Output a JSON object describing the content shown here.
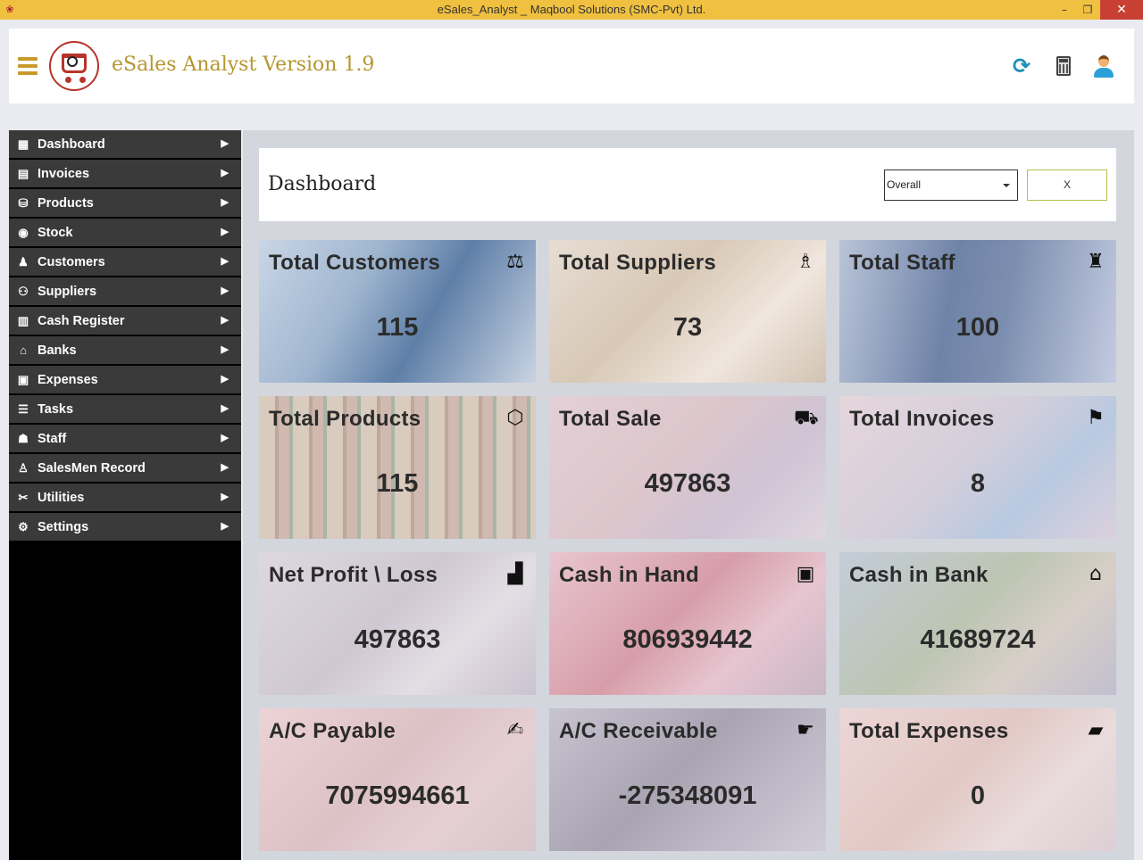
{
  "window": {
    "title": "eSales_Analyst _ Maqbool Solutions (SMC-Pvt) Ltd.",
    "minimize": "–",
    "maximize": "❐",
    "close": "✕"
  },
  "header": {
    "app_name": "eSales Analyst Version 1.9",
    "icons": [
      "refresh-icon",
      "calculator-icon",
      "user-icon"
    ]
  },
  "sidebar": {
    "items": [
      {
        "label": "Dashboard",
        "icon": "dashboard-icon"
      },
      {
        "label": "Invoices",
        "icon": "invoice-icon"
      },
      {
        "label": "Products",
        "icon": "products-icon"
      },
      {
        "label": "Stock",
        "icon": "stock-icon"
      },
      {
        "label": "Customers",
        "icon": "customers-icon"
      },
      {
        "label": "Suppliers",
        "icon": "suppliers-icon"
      },
      {
        "label": "Cash Register",
        "icon": "cash-register-icon"
      },
      {
        "label": "Banks",
        "icon": "bank-icon"
      },
      {
        "label": "Expenses",
        "icon": "expenses-icon"
      },
      {
        "label": "Tasks",
        "icon": "tasks-icon"
      },
      {
        "label": "Staff",
        "icon": "staff-icon"
      },
      {
        "label": "SalesMen Record",
        "icon": "salesmen-icon"
      },
      {
        "label": "Utilities",
        "icon": "utilities-icon"
      },
      {
        "label": "Settings",
        "icon": "settings-icon"
      }
    ]
  },
  "dashboard": {
    "title": "Dashboard",
    "filter_value": "Overall",
    "close_label": "X",
    "cards": [
      {
        "label": "Total Customers",
        "value": "115"
      },
      {
        "label": "Total Suppliers",
        "value": "73"
      },
      {
        "label": "Total Staff",
        "value": "100"
      },
      {
        "label": "Total Products",
        "value": "115"
      },
      {
        "label": "Total Sale",
        "value": "497863"
      },
      {
        "label": "Total Invoices",
        "value": "8"
      },
      {
        "label": "Net Profit \\ Loss",
        "value": "497863"
      },
      {
        "label": "Cash in Hand",
        "value": "806939442"
      },
      {
        "label": "Cash in Bank",
        "value": "41689724"
      },
      {
        "label": "A/C Payable",
        "value": "7075994661"
      },
      {
        "label": "A/C Receivable",
        "value": "-275348091"
      },
      {
        "label": "Total Expenses",
        "value": "0"
      }
    ]
  }
}
